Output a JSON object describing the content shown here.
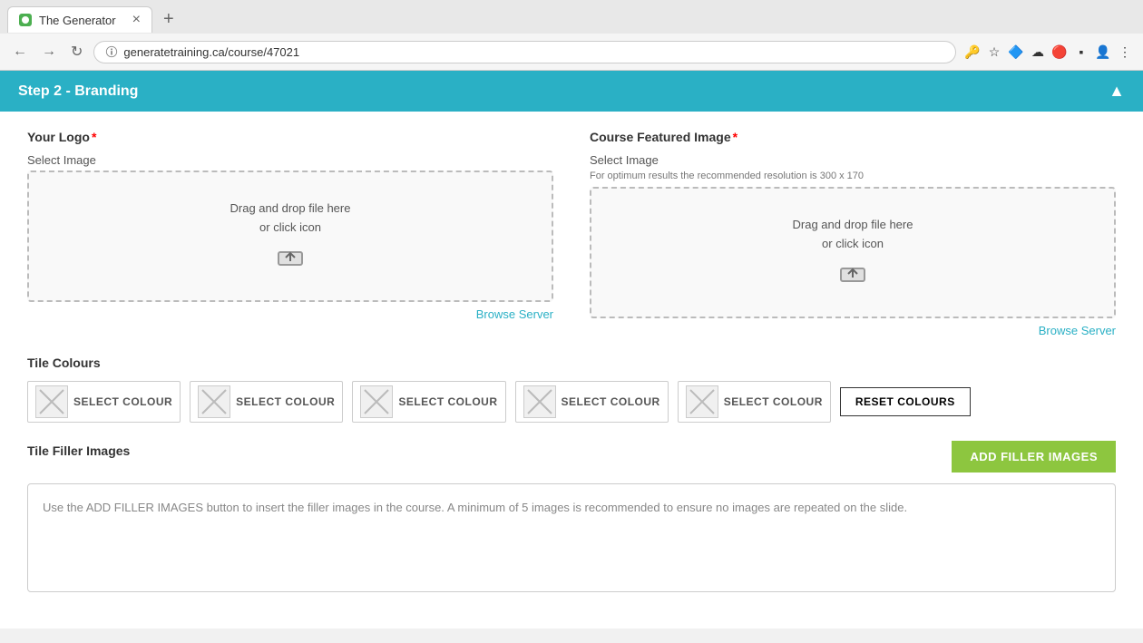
{
  "browser": {
    "tab_title": "The Generator",
    "tab_close": "×",
    "new_tab": "+",
    "url": "generatetraining.ca/course/47021",
    "back": "←",
    "forward": "→",
    "refresh": "↻"
  },
  "page": {
    "step_header": "Step 2 - Branding",
    "collapse_icon": "▲",
    "logo_section": {
      "label": "Your Logo",
      "required": "*",
      "select_image": "Select Image",
      "drop_text_line1": "Drag and drop file here",
      "drop_text_line2": "or click icon",
      "browse_link": "Browse Server"
    },
    "featured_section": {
      "label": "Course Featured Image",
      "required": "*",
      "select_image": "Select Image",
      "resolution_hint": "For optimum results the recommended resolution is 300 x 170",
      "drop_text_line1": "Drag and drop file here",
      "drop_text_line2": "or click icon",
      "browse_link": "Browse Server"
    },
    "tile_colours": {
      "label": "Tile Colours",
      "colours": [
        {
          "label": "SELECT COLOUR"
        },
        {
          "label": "SELECT COLOUR"
        },
        {
          "label": "SELECT COLOUR"
        },
        {
          "label": "SELECT COLOUR"
        },
        {
          "label": "SELECT COLOUR"
        }
      ],
      "reset_btn": "RESET COLOURS"
    },
    "filler_images": {
      "label": "Tile Filler Images",
      "add_btn": "ADD FILLER IMAGES",
      "info_text": "Use the ADD FILLER IMAGES button to insert the filler images in the course. A minimum of 5 images is recommended to ensure no images are repeated on the slide."
    }
  }
}
